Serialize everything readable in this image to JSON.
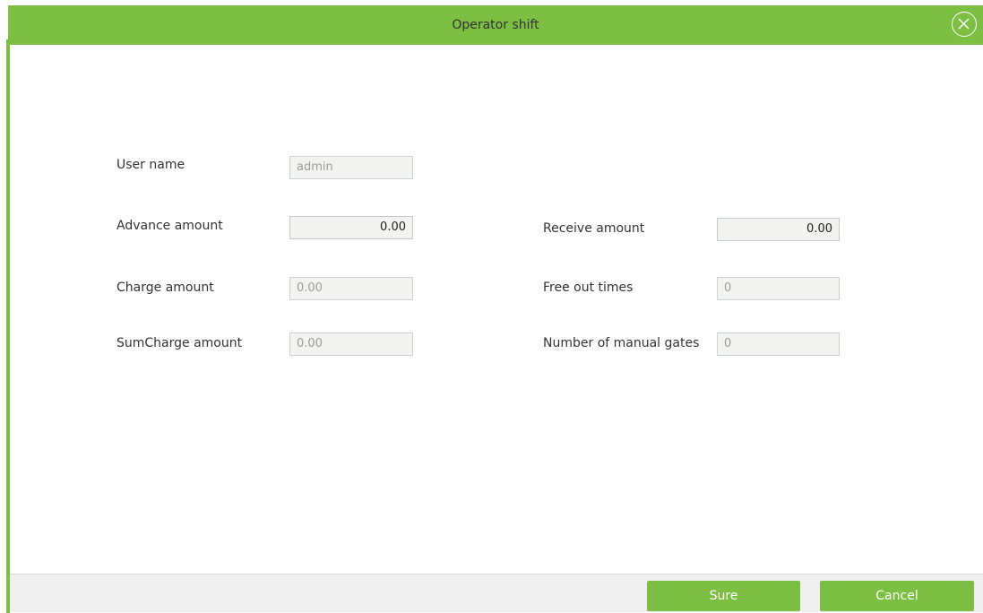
{
  "dialog": {
    "title": "Operator shift",
    "close_icon": "close-circle-icon",
    "accent_color": "#7cbf42"
  },
  "form": {
    "user_name": {
      "label": "User name",
      "value": "admin"
    },
    "advance_amount": {
      "label": "Advance amount",
      "value": "0.00"
    },
    "charge_amount": {
      "label": "Charge amount",
      "value": "0.00"
    },
    "sumcharge_amount": {
      "label": "SumCharge amount",
      "value": "0.00"
    },
    "receive_amount": {
      "label": "Receive amount",
      "value": "0.00"
    },
    "free_out_times": {
      "label": "Free out times",
      "value": "0"
    },
    "manual_gates": {
      "label": "Number of manual gates",
      "value": "0"
    }
  },
  "footer": {
    "sure_label": "Sure",
    "cancel_label": "Cancel"
  }
}
